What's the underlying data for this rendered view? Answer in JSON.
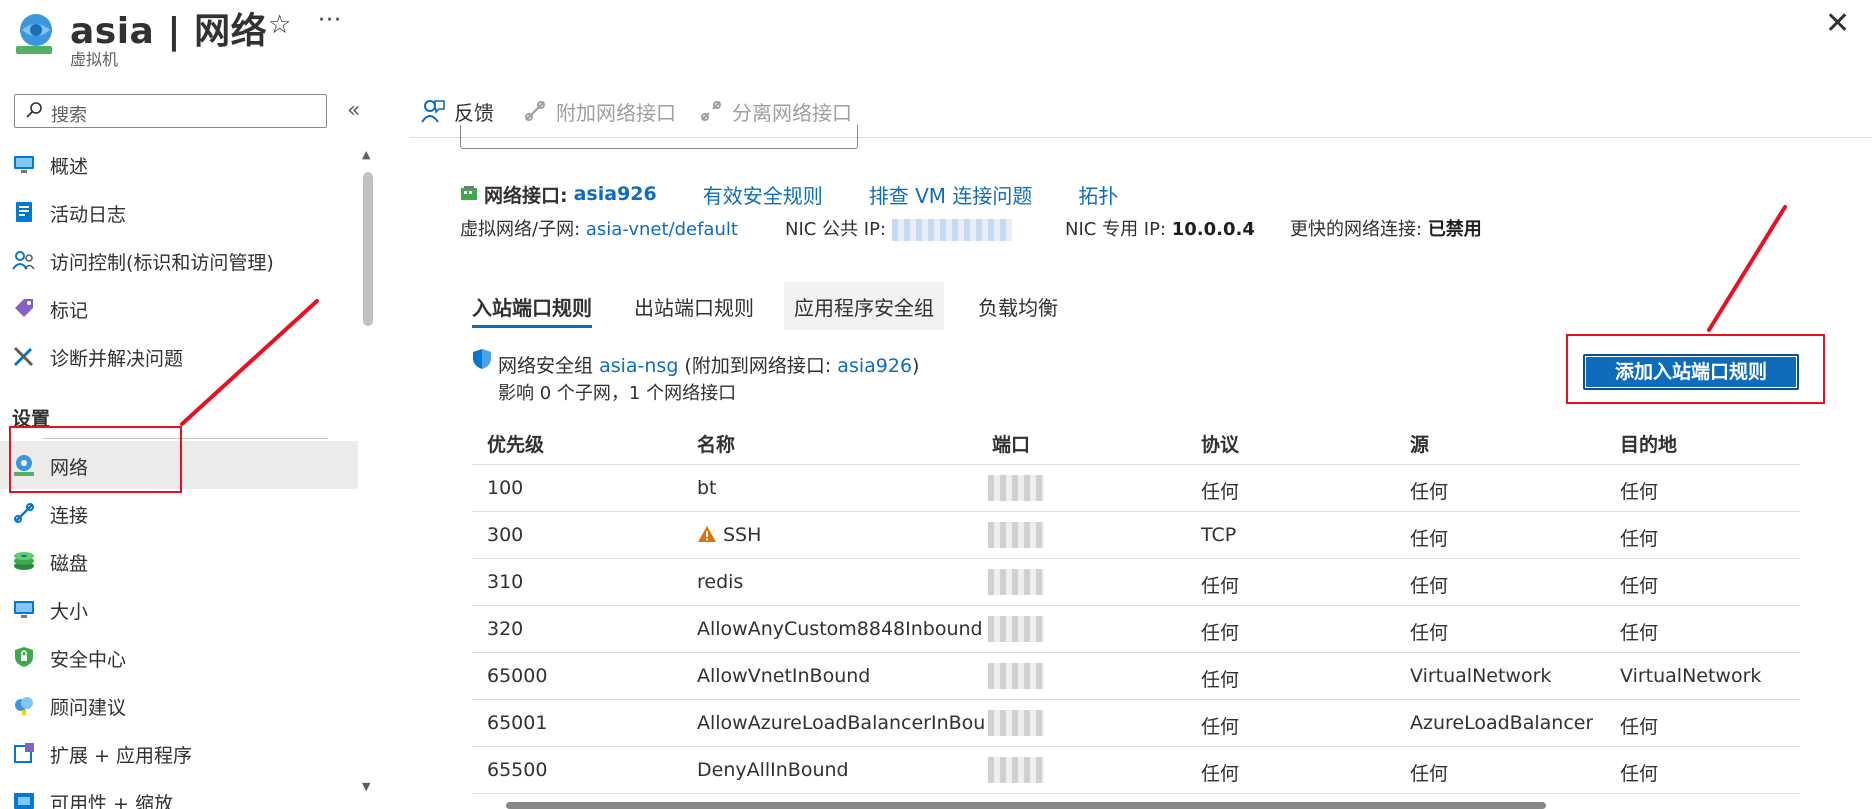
{
  "header": {
    "title": "asia | 网络",
    "subtitle": "虚拟机",
    "favorite_glyph": "☆",
    "more_glyph": "···",
    "close_glyph": "✕"
  },
  "sidebar": {
    "search_placeholder": "搜索",
    "collapse_glyph": "«",
    "items": [
      {
        "label": "概述",
        "icon": "overview-icon"
      },
      {
        "label": "活动日志",
        "icon": "activity-log-icon"
      },
      {
        "label": "访问控制(标识和访问管理)",
        "icon": "access-control-icon"
      },
      {
        "label": "标记",
        "icon": "tag-icon"
      },
      {
        "label": "诊断并解决问题",
        "icon": "diagnose-icon"
      }
    ],
    "section_settings": "设置",
    "settings_items": [
      {
        "label": "网络",
        "icon": "networking-icon",
        "active": true
      },
      {
        "label": "连接",
        "icon": "connect-icon"
      },
      {
        "label": "磁盘",
        "icon": "disks-icon"
      },
      {
        "label": "大小",
        "icon": "size-icon"
      },
      {
        "label": "安全中心",
        "icon": "security-icon"
      },
      {
        "label": "顾问建议",
        "icon": "advisor-icon"
      },
      {
        "label": "扩展 + 应用程序",
        "icon": "extensions-icon"
      },
      {
        "label": "可用性 + 缩放",
        "icon": "availability-icon"
      }
    ]
  },
  "toolbar": {
    "feedback": "反馈",
    "attach_nic": "附加网络接口",
    "detach_nic": "分离网络接口"
  },
  "nic": {
    "label": "网络接口:",
    "name": "asia926",
    "effective_rules": "有效安全规则",
    "troubleshoot": "排查 VM 连接问题",
    "topology": "拓扑",
    "vnet_label": "虚拟网络/子网:",
    "vnet_value": "asia-vnet/default",
    "public_ip_label": "NIC 公共 IP:",
    "private_ip_label": "NIC 专用 IP:",
    "private_ip_value": "10.0.0.4",
    "accel_label": "更快的网络连接:",
    "accel_value": "已禁用"
  },
  "tabs": [
    "入站端口规则",
    "出站端口规则",
    "应用程序安全组",
    "负载均衡"
  ],
  "nsg": {
    "prefix": "网络安全组",
    "name": "asia-nsg",
    "attached_prefix": " (附加到网络接口: ",
    "attached_nic": "asia926",
    "attached_suffix": ")",
    "impact": "影响 0 个子网，1 个网络接口"
  },
  "add_button": "添加入站端口规则",
  "table": {
    "headers": [
      "优先级",
      "名称",
      "端口",
      "协议",
      "源",
      "目的地"
    ],
    "rows": [
      {
        "priority": "100",
        "name": "bt",
        "warn": false,
        "protocol": "任何",
        "source": "任何",
        "destination": "任何"
      },
      {
        "priority": "300",
        "name": "SSH",
        "warn": true,
        "protocol": "TCP",
        "source": "任何",
        "destination": "任何"
      },
      {
        "priority": "310",
        "name": "redis",
        "warn": false,
        "protocol": "任何",
        "source": "任何",
        "destination": "任何"
      },
      {
        "priority": "320",
        "name": "AllowAnyCustom8848Inbound",
        "warn": false,
        "protocol": "任何",
        "source": "任何",
        "destination": "任何"
      },
      {
        "priority": "65000",
        "name": "AllowVnetInBound",
        "warn": false,
        "protocol": "任何",
        "source": "VirtualNetwork",
        "destination": "VirtualNetwork"
      },
      {
        "priority": "65001",
        "name": "AllowAzureLoadBalancerInBou...",
        "warn": false,
        "protocol": "任何",
        "source": "AzureLoadBalancer",
        "destination": "任何"
      },
      {
        "priority": "65500",
        "name": "DenyAllInBound",
        "warn": false,
        "protocol": "任何",
        "source": "任何",
        "destination": "任何"
      }
    ]
  },
  "colors": {
    "accent": "#0f6cbd",
    "annotation_red": "#e81123",
    "active_bg": "#edebe9"
  }
}
